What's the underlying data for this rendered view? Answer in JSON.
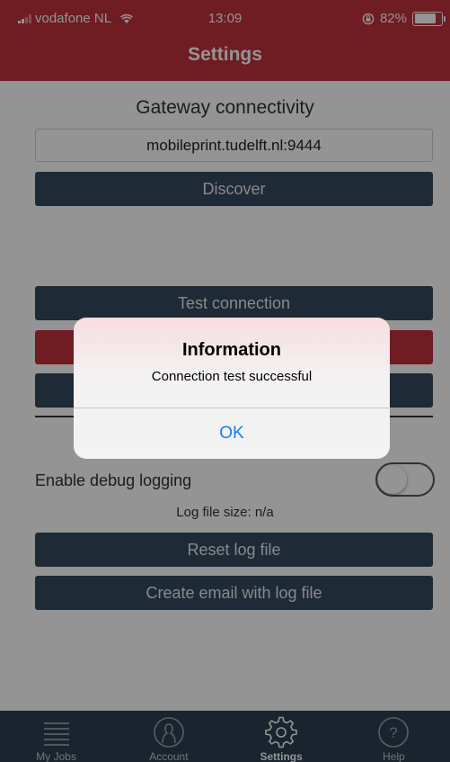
{
  "status_bar": {
    "carrier": "vodafone NL",
    "time": "13:09",
    "battery": "82%",
    "battery_level": 0.82
  },
  "header": {
    "title": "Settings"
  },
  "gateway": {
    "section_title": "Gateway connectivity",
    "address": "mobileprint.tudelft.nl:9444",
    "discover_label": "Discover"
  },
  "connection": {
    "test_label": "Test connection"
  },
  "debug": {
    "enable_label": "Enable debug logging",
    "enabled": false,
    "log_size": "Log file size:  n/a",
    "reset_label": "Reset log file",
    "email_label": "Create email with log file"
  },
  "tabbar": {
    "items": [
      {
        "label": "My Jobs",
        "icon": "list-icon"
      },
      {
        "label": "Account",
        "icon": "person-icon"
      },
      {
        "label": "Settings",
        "icon": "gear-icon",
        "active": true
      },
      {
        "label": "Help",
        "icon": "question-icon"
      }
    ]
  },
  "alert": {
    "title": "Information",
    "message": "Connection test successful",
    "ok_label": "OK"
  },
  "colors": {
    "header_red": "#c0313b",
    "button_navy": "#34495e",
    "tabbar": "#2c3e50",
    "alert_link": "#1a7bf0"
  }
}
